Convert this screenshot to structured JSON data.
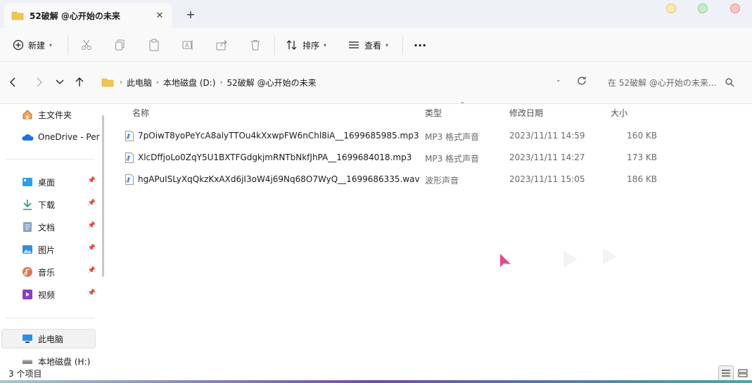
{
  "window": {
    "tab_title": "52破解 @心开始の未来",
    "tab_close": "✕",
    "new_tab": "+"
  },
  "toolbar": {
    "new_label": "新建",
    "sort_label": "排序",
    "view_label": "查看",
    "more": "···"
  },
  "address": {
    "crumbs": [
      "此电脑",
      "本地磁盘 (D:)",
      "52破解 @心开始の未来"
    ],
    "search_placeholder": "在 52破解 @心开始の未来..."
  },
  "sidebar": {
    "home": "主文件夹",
    "onedrive": "OneDrive - Per",
    "quick": [
      "桌面",
      "下载",
      "文档",
      "图片",
      "音乐",
      "视频"
    ],
    "this_pc": "此电脑",
    "drive": "本地磁盘 (H:)"
  },
  "columns": {
    "name": "名称",
    "type": "类型",
    "modified": "修改日期",
    "size": "大小"
  },
  "files": [
    {
      "name": "7pOiwT8yoPeYcA8alyTTOu4kXxwpFW6nChl8iA__1699685985.mp3",
      "type": "MP3 格式声音",
      "modified": "2023/11/11 14:59",
      "size": "160 KB"
    },
    {
      "name": "XlcDffjoLo0ZqY5U1BXTFGdgkjmRNTbNkfJhPA__1699684018.mp3",
      "type": "MP3 格式声音",
      "modified": "2023/11/11 14:27",
      "size": "173 KB"
    },
    {
      "name": "hgAPuISLyXqQkzKxAXd6jI3oW4j69Nq68O7WyQ__1699686335.wav",
      "type": "波形声音",
      "modified": "2023/11/11 15:05",
      "size": "186 KB"
    }
  ],
  "status": {
    "count": "3 个项目"
  },
  "colors": {
    "accent": "#0067c0",
    "folder": "#f3c54c"
  }
}
